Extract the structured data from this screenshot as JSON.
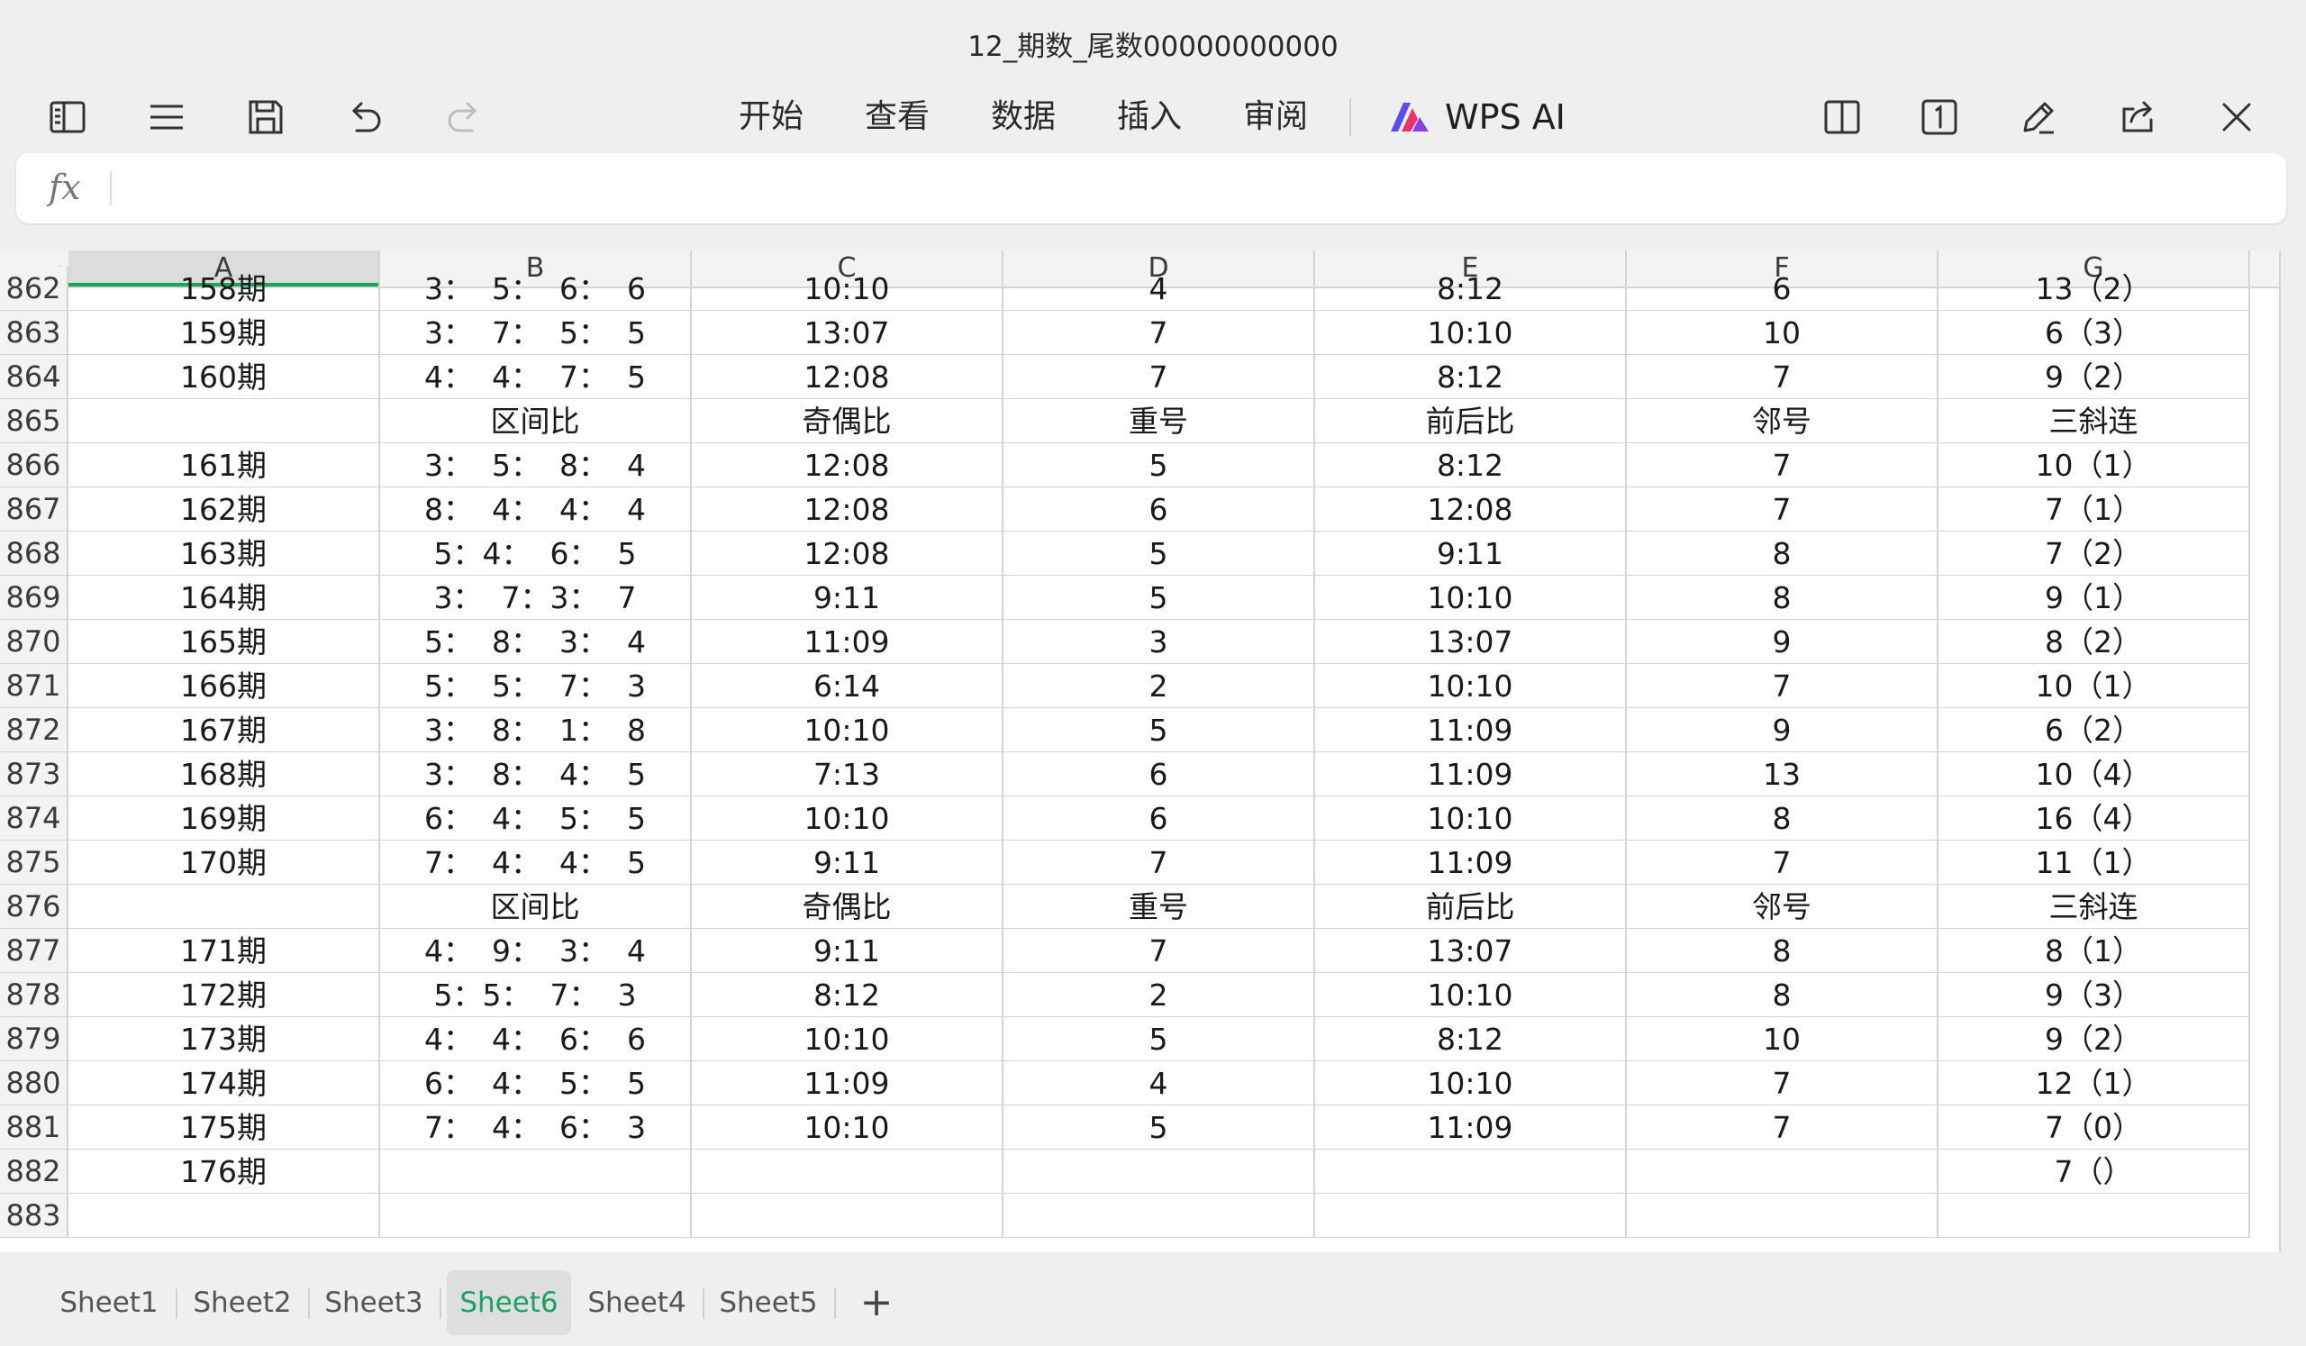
{
  "window": {
    "title": "12_期数_尾数00000000000"
  },
  "toolbar": {
    "menu": [
      "开始",
      "查看",
      "数据",
      "插入",
      "审阅"
    ],
    "ai_label": "WPS AI"
  },
  "formula_bar": {
    "fx": "fx",
    "value": ""
  },
  "columns": [
    "A",
    "B",
    "C",
    "D",
    "E",
    "F",
    "G"
  ],
  "rows": [
    {
      "num": "862",
      "cells": [
        "158期",
        "3：  5：  6：  6",
        "10:10",
        "4",
        "8:12",
        "6",
        "13（2）"
      ]
    },
    {
      "num": "863",
      "cells": [
        "159期",
        "3：  7：  5：  5",
        "13:07",
        "7",
        "10:10",
        "10",
        "6（3）"
      ]
    },
    {
      "num": "864",
      "cells": [
        "160期",
        "4：  4：  7：  5",
        "12:08",
        "7",
        "8:12",
        "7",
        "9（2）"
      ]
    },
    {
      "num": "865",
      "cells": [
        "",
        "区间比",
        "奇偶比",
        "重号",
        "前后比",
        "邻号",
        "三斜连"
      ]
    },
    {
      "num": "866",
      "cells": [
        "161期",
        "3：  5：  8：  4",
        "12:08",
        "5",
        "8:12",
        "7",
        "10（1）"
      ]
    },
    {
      "num": "867",
      "cells": [
        "162期",
        "8：  4：  4：  4",
        "12:08",
        "6",
        "12:08",
        "7",
        "7（1）"
      ]
    },
    {
      "num": "868",
      "cells": [
        "163期",
        "5：4：  6：  5",
        "12:08",
        "5",
        "9:11",
        "8",
        "7（2）"
      ]
    },
    {
      "num": "869",
      "cells": [
        "164期",
        "3：  7：3：  7",
        "9:11",
        "5",
        "10:10",
        "8",
        "9（1）"
      ]
    },
    {
      "num": "870",
      "cells": [
        "165期",
        "5：  8：  3：  4",
        "11:09",
        "3",
        "13:07",
        "9",
        "8（2）"
      ]
    },
    {
      "num": "871",
      "cells": [
        "166期",
        "5：  5：  7：  3",
        "6:14",
        "2",
        "10:10",
        "7",
        "10（1）"
      ]
    },
    {
      "num": "872",
      "cells": [
        "167期",
        "3：  8：  1：  8",
        "10:10",
        "5",
        "11:09",
        "9",
        "6（2）"
      ]
    },
    {
      "num": "873",
      "cells": [
        "168期",
        "3：  8：  4：  5",
        "7:13",
        "6",
        "11:09",
        "13",
        "10（4）"
      ]
    },
    {
      "num": "874",
      "cells": [
        "169期",
        "6：  4：  5：  5",
        "10:10",
        "6",
        "10:10",
        "8",
        "16（4）"
      ]
    },
    {
      "num": "875",
      "cells": [
        "170期",
        "7：  4：  4：  5",
        "9:11",
        "7",
        "11:09",
        "7",
        "11（1）"
      ]
    },
    {
      "num": "876",
      "cells": [
        "",
        "区间比",
        "奇偶比",
        "重号",
        "前后比",
        "邻号",
        "三斜连"
      ]
    },
    {
      "num": "877",
      "cells": [
        "171期",
        "4：  9：  3：  4",
        "9:11",
        "7",
        "13:07",
        "8",
        "8（1）"
      ]
    },
    {
      "num": "878",
      "cells": [
        "172期",
        "5：5：  7：  3",
        "8:12",
        "2",
        "10:10",
        "8",
        "9（3）"
      ]
    },
    {
      "num": "879",
      "cells": [
        "173期",
        "4：  4：  6：  6",
        "10:10",
        "5",
        "8:12",
        "10",
        "9（2）"
      ]
    },
    {
      "num": "880",
      "cells": [
        "174期",
        "6：  4：  5：  5",
        "11:09",
        "4",
        "10:10",
        "7",
        "12（1）"
      ]
    },
    {
      "num": "881",
      "cells": [
        "175期",
        "7：  4：  6：  3",
        "10:10",
        "5",
        "11:09",
        "7",
        "7（0）"
      ]
    },
    {
      "num": "882",
      "cells": [
        "176期",
        "",
        "",
        "",
        "",
        "",
        "7（）"
      ]
    },
    {
      "num": "883",
      "cells": [
        "",
        "",
        "",
        "",
        "",
        "",
        ""
      ]
    }
  ],
  "sheet_tabs": [
    "Sheet1",
    "Sheet2",
    "Sheet3",
    "Sheet6",
    "Sheet4",
    "Sheet5"
  ],
  "active_sheet": "Sheet6",
  "colors": {
    "accent": "#1aa260",
    "grid_line": "#d4d4d4",
    "header_bg": "#f3f3f3"
  }
}
